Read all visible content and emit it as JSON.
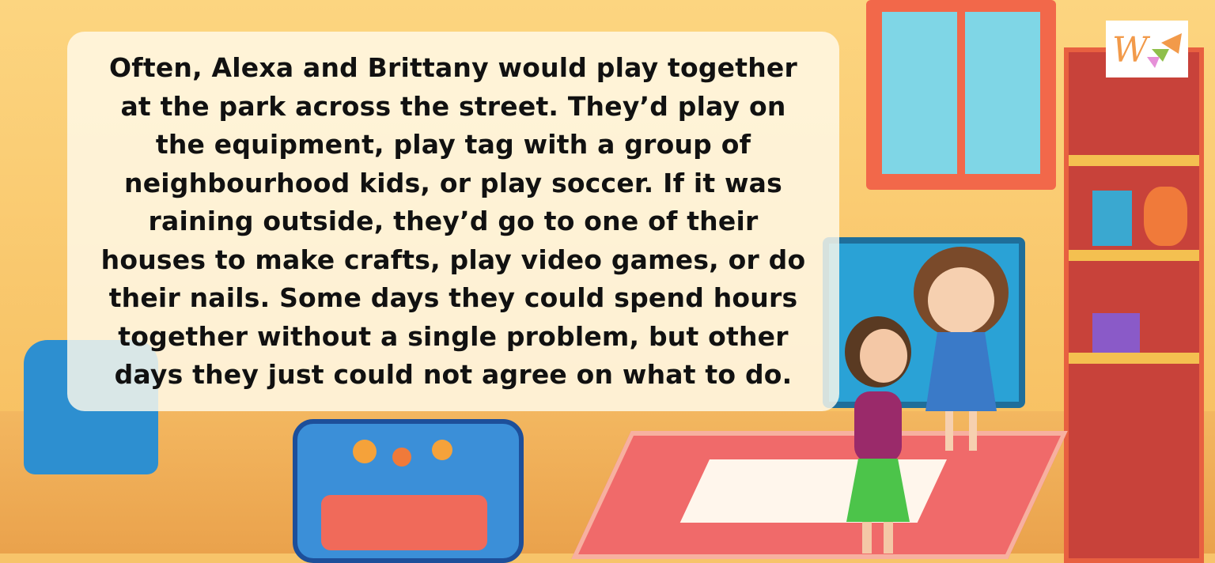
{
  "story": {
    "lines": [
      "Often, Alexa and Brittany would play together",
      "at the park across the street. They’d play on",
      "the equipment, play tag with a group of",
      "neighbourhood kids, or play soccer. If it was",
      "raining outside, they’d go to one of their",
      "houses to make crafts, play video games, or do",
      "their nails. Some days they could spend hours",
      "together without a single problem, but other",
      "days they just could not agree on what to do."
    ]
  },
  "logo": {
    "letter": "W",
    "icon": "bunting-flags-logo"
  },
  "colors": {
    "text_panel": "#fffaeb",
    "text": "#111111",
    "logo_orange": "#f29a4a",
    "logo_green": "#8fbf4a",
    "logo_pink": "#e690d8"
  }
}
